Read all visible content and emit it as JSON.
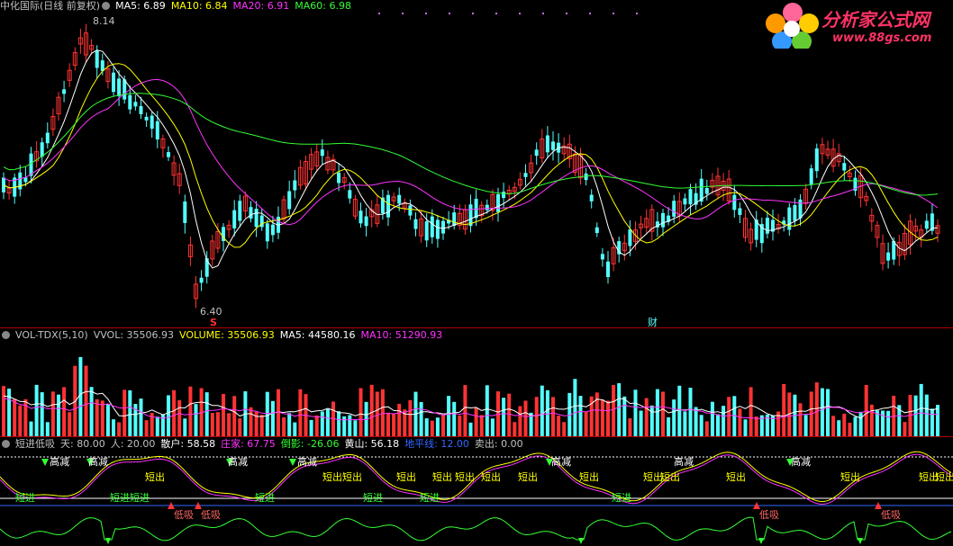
{
  "main_panel": {
    "title": "中化国际(日线 前复权)",
    "indicators": [
      {
        "label": "MA5: 6.89",
        "color": "#ffffff"
      },
      {
        "label": "MA10: 6.84",
        "color": "#ffff00"
      },
      {
        "label": "MA20: 6.91",
        "color": "#ff33ff"
      },
      {
        "label": "MA60: 6.98",
        "color": "#33ff33"
      }
    ],
    "high_label": "8.14",
    "low_label": "6.40",
    "marker_s": "S",
    "marker_cai": "财"
  },
  "volume_panel": {
    "indicators": [
      {
        "label": "VOL-TDX(5,10)",
        "color": "#c0c0c0"
      },
      {
        "label": "VVOL: 35506.93",
        "color": "#c0c0c0"
      },
      {
        "label": "VOLUME: 35506.93",
        "color": "#ffff00"
      },
      {
        "label": "MA5: 44580.16",
        "color": "#ffffff"
      },
      {
        "label": "MA10: 51290.93",
        "color": "#ff33ff"
      }
    ]
  },
  "signal_panel": {
    "indicators": [
      {
        "label": "短进低吸",
        "color": "#c0c0c0"
      },
      {
        "label": "天: 80.00",
        "color": "#c0c0c0"
      },
      {
        "label": "人: 20.00",
        "color": "#c0c0c0"
      },
      {
        "label": "散户: 58.58",
        "color": "#ffffff"
      },
      {
        "label": "庄家: 67.75",
        "color": "#ff33ff"
      },
      {
        "label": "倒影: -26.06",
        "color": "#33ff33"
      },
      {
        "label": "黄山: 56.18",
        "color": "#ffffff"
      },
      {
        "label": "地平线: 12.00",
        "color": "#3366ff"
      },
      {
        "label": "卖出: 0.00",
        "color": "#c0c0c0"
      }
    ],
    "labels": {
      "gaojian": "高减",
      "duanchu": "短出",
      "duanjin": "短进",
      "dixi": "低吸"
    }
  },
  "logo": {
    "text": "分析家公式网",
    "url": "www.88gs.com"
  },
  "colors": {
    "up": "#ff3333",
    "down": "#54ffff",
    "ma5": "#ffffff",
    "ma10": "#ffff00",
    "ma20": "#ff33ff",
    "ma60": "#33ff33",
    "divider": "#b00000"
  }
}
